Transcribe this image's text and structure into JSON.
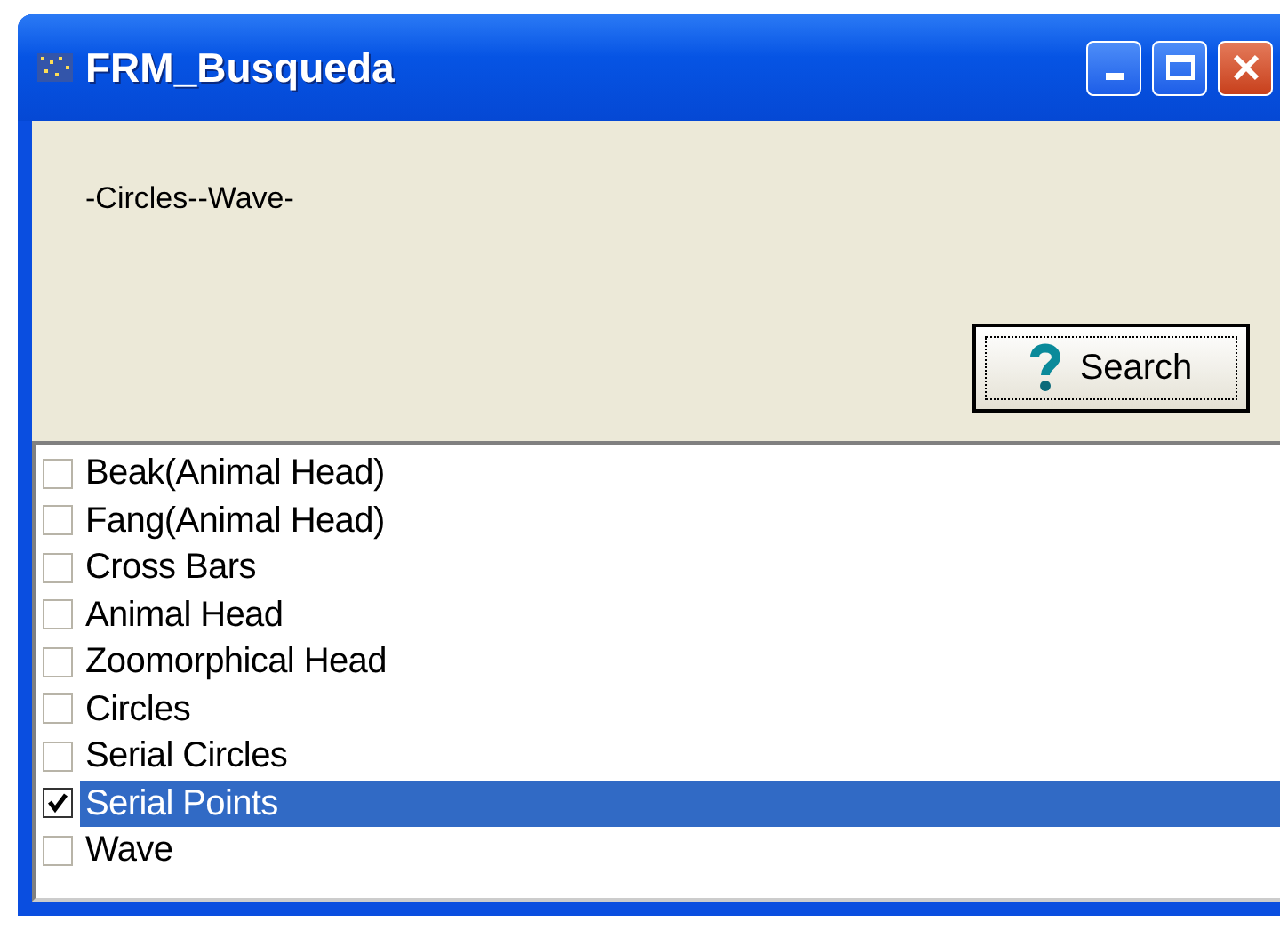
{
  "window": {
    "title": "FRM_Busqueda"
  },
  "selection_label": "-Circles--Wave-",
  "search_button": {
    "label": "Search"
  },
  "items": [
    {
      "label": "Beak(Animal Head)",
      "checked": false,
      "selected": false
    },
    {
      "label": "Fang(Animal Head)",
      "checked": false,
      "selected": false
    },
    {
      "label": "Cross Bars",
      "checked": false,
      "selected": false
    },
    {
      "label": "Animal Head",
      "checked": false,
      "selected": false
    },
    {
      "label": "Zoomorphical Head",
      "checked": false,
      "selected": false
    },
    {
      "label": "Circles",
      "checked": false,
      "selected": false
    },
    {
      "label": "Serial Circles",
      "checked": false,
      "selected": false
    },
    {
      "label": "Serial Points",
      "checked": true,
      "selected": true
    },
    {
      "label": "Wave",
      "checked": false,
      "selected": false
    }
  ]
}
